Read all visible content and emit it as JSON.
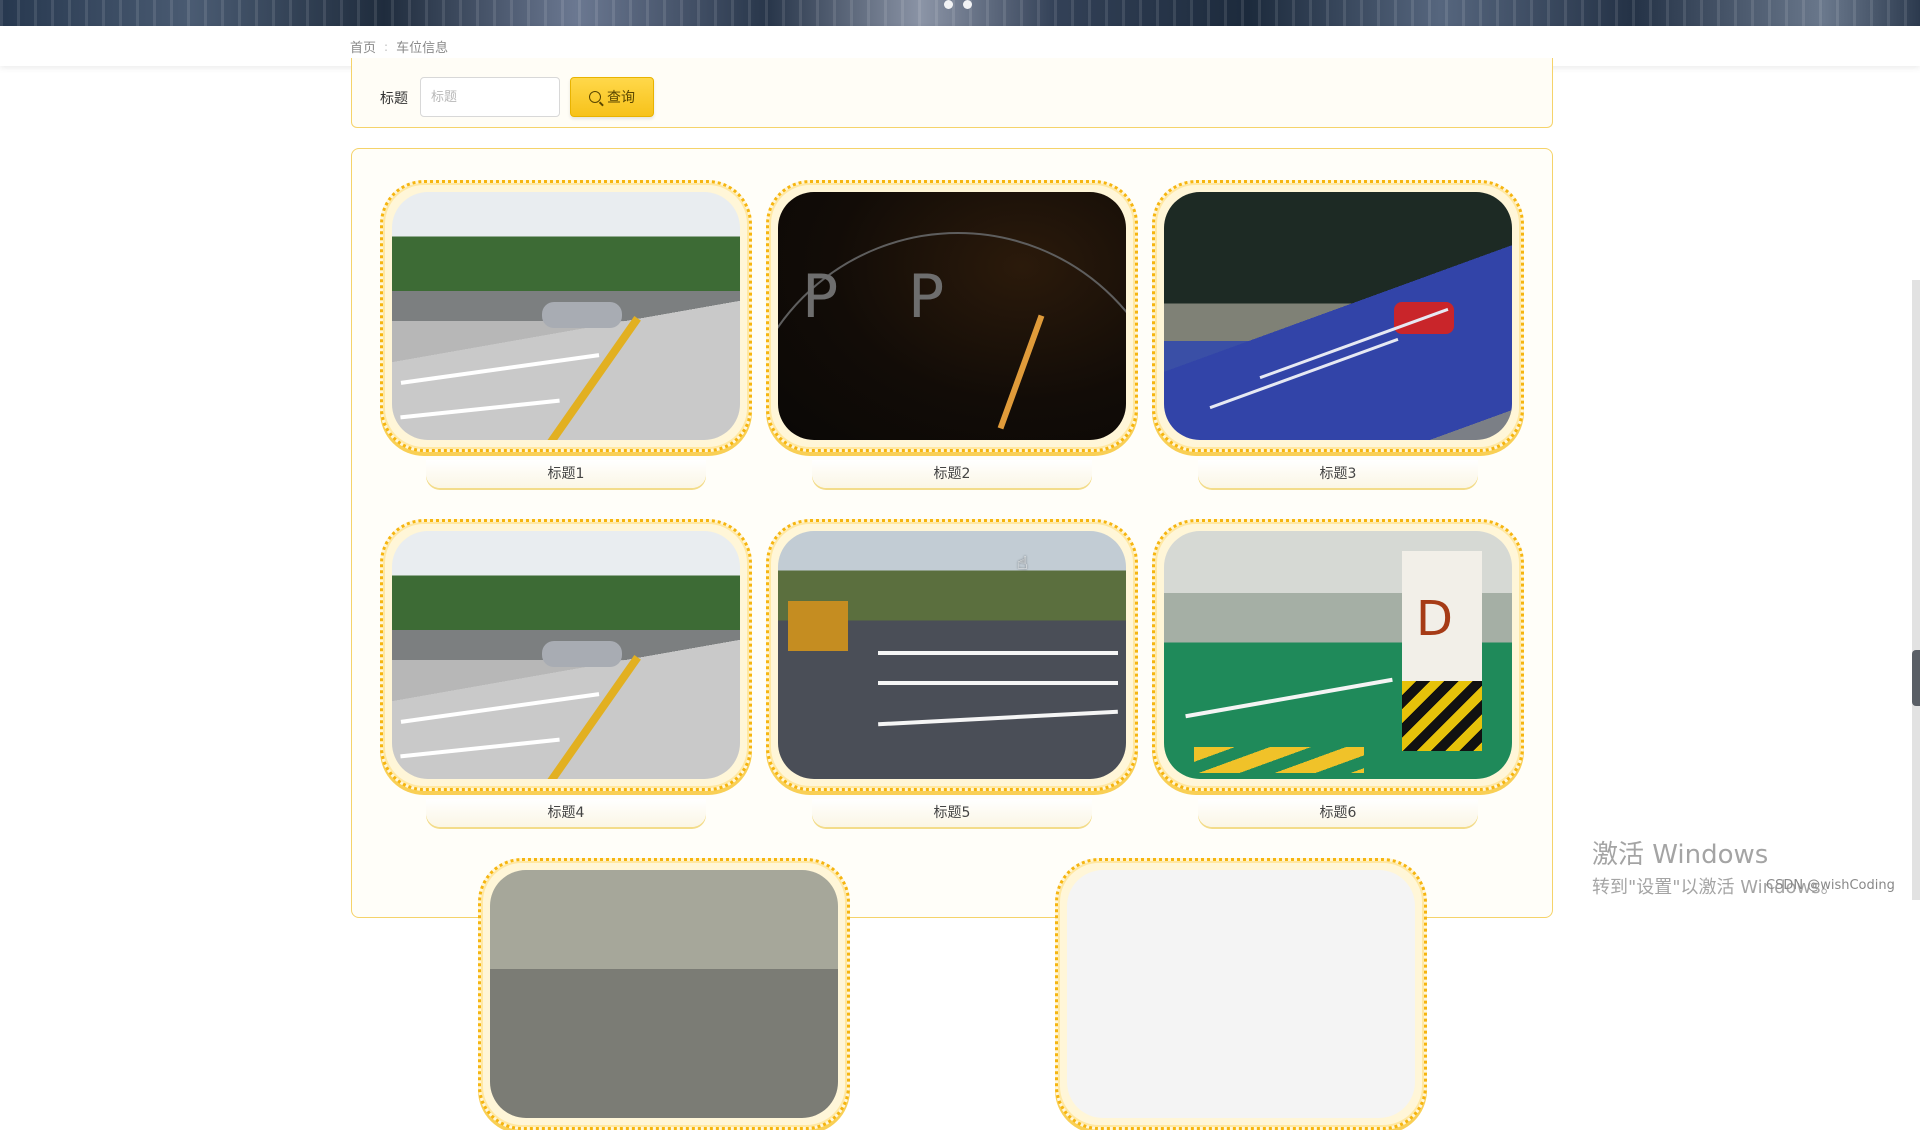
{
  "breadcrumb": {
    "home": "首页",
    "separator": ":",
    "current": "车位信息"
  },
  "search": {
    "label": "标题",
    "placeholder": "标题",
    "value": "",
    "button_label": "查询",
    "button_icon": "search-icon"
  },
  "cards": [
    {
      "title": "标题1",
      "scene": "outdoor-parking-lot"
    },
    {
      "title": "标题2",
      "scene": "dark-parking-graphic"
    },
    {
      "title": "标题3",
      "scene": "blue-painted-parking-space"
    },
    {
      "title": "标题4",
      "scene": "outdoor-parking-lot"
    },
    {
      "title": "标题5",
      "scene": "asphalt-parking-lot"
    },
    {
      "title": "标题6",
      "scene": "underground-garage"
    }
  ],
  "watermark": {
    "line1": "激活 Windows",
    "line2": "转到\"设置\"以激活 Windows。"
  },
  "credit": "CSDN @wishCoding",
  "theme": {
    "accent": "#f7c21a",
    "border": "#f5d36a",
    "dotted_frame": "#f6b510"
  }
}
